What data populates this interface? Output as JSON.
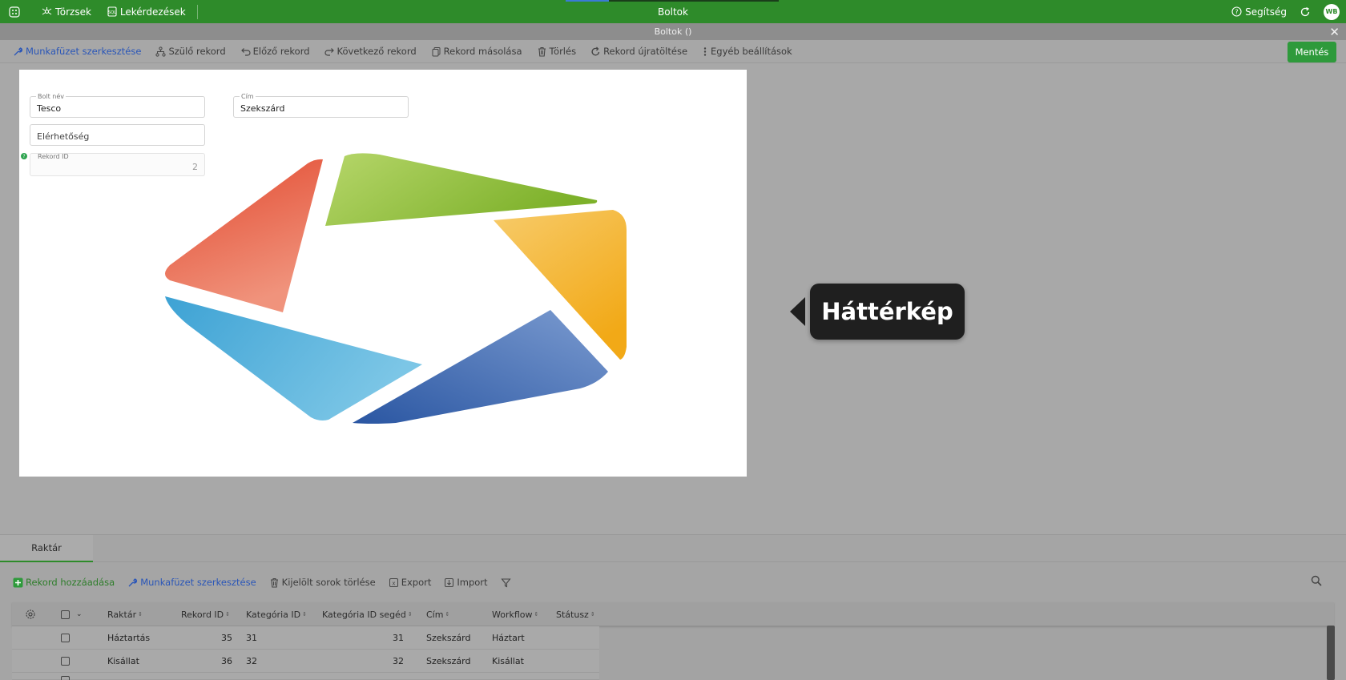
{
  "topbar": {
    "apps_icon": "grid-icon",
    "nav": [
      {
        "label": "Törzsek",
        "icon": "molecule-icon"
      },
      {
        "label": "Lekérdezések",
        "icon": "query-icon"
      }
    ],
    "title": "Boltok",
    "help_label": "Segítség",
    "avatar_initials": "WB"
  },
  "window": {
    "title": "Boltok ()"
  },
  "toolbar": {
    "items": [
      {
        "label": "Munkafüzet szerkesztése",
        "icon": "wrench-icon"
      },
      {
        "label": "Szülő rekord",
        "icon": "hierarchy-icon"
      },
      {
        "label": "Előző rekord",
        "icon": "undo-icon"
      },
      {
        "label": "Következő rekord",
        "icon": "redo-icon"
      },
      {
        "label": "Rekord másolása",
        "icon": "copy-icon"
      },
      {
        "label": "Törlés",
        "icon": "trash-icon"
      },
      {
        "label": "Rekord újratöltése",
        "icon": "reload-icon"
      },
      {
        "label": "Egyéb beállítások",
        "icon": "more-vertical-icon"
      }
    ],
    "save_label": "Mentés"
  },
  "form": {
    "bolt_nev": {
      "label": "Bolt név",
      "value": "Tesco"
    },
    "cim": {
      "label": "Cím",
      "value": "Szekszárd"
    },
    "elerhetoseg": {
      "placeholder": "Elérhetőség"
    },
    "rekord_id": {
      "label": "Rekord ID",
      "value": "2"
    }
  },
  "tooltip": {
    "text": "Háttérkép"
  },
  "colors": {
    "brand_green": "#2e8b2a",
    "logo_red": "#e8553a",
    "logo_green": "#8dbf3a",
    "logo_yellow": "#f4b026",
    "logo_blue": "#3f6fb0",
    "logo_lightblue": "#4cb0dc"
  },
  "lower": {
    "tab": "Raktár",
    "toolbar": [
      {
        "label": "Rekord hozzáadása",
        "icon": "plus-icon"
      },
      {
        "label": "Munkafüzet szerkesztése",
        "icon": "wrench-icon"
      },
      {
        "label": "Kijelölt sorok törlése",
        "icon": "trash-icon"
      },
      {
        "label": "Export",
        "icon": "export-icon"
      },
      {
        "label": "Import",
        "icon": "import-icon"
      }
    ],
    "columns": [
      "Raktár",
      "Rekord ID",
      "Kategória ID",
      "Kategória ID segéd",
      "Cím",
      "Workflow",
      "Státusz"
    ],
    "rows": [
      {
        "raktar": "Háztartás",
        "rekord_id": "35",
        "kategoria_id": "31",
        "kategoria_seged": "31",
        "cim": "Szekszárd",
        "workflow": "Háztart"
      },
      {
        "raktar": "Kisállat",
        "rekord_id": "36",
        "kategoria_id": "32",
        "kategoria_seged": "32",
        "cim": "Szekszárd",
        "workflow": "Kisállat"
      }
    ]
  }
}
